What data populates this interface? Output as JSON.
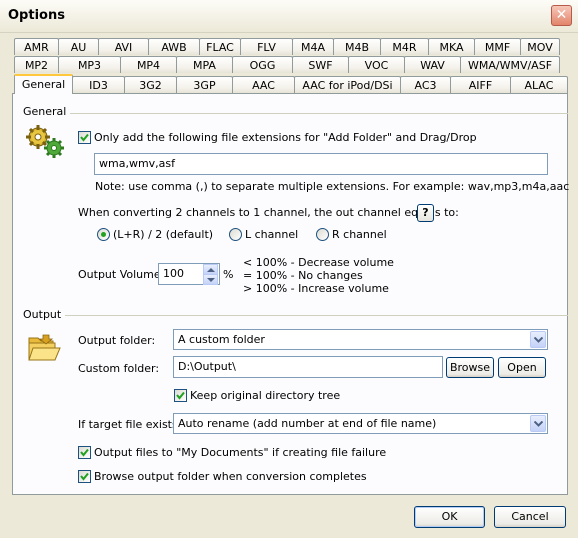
{
  "window": {
    "title": "Options",
    "close_glyph": "✕"
  },
  "tabs_row1": [
    "AMR",
    "AU",
    "AVI",
    "AWB",
    "FLAC",
    "FLV",
    "M4A",
    "M4B",
    "M4R",
    "MKA",
    "MMF",
    "MOV"
  ],
  "tabs_row2": [
    "MP2",
    "MP3",
    "MP4",
    "MPA",
    "OGG",
    "SWF",
    "VOC",
    "WAV",
    "WMA/WMV/ASF"
  ],
  "tabs_row3": [
    "General",
    "ID3",
    "3G2",
    "3GP",
    "AAC",
    "AAC for iPod/DSi",
    "AC3",
    "AIFF",
    "ALAC"
  ],
  "active_tab": "General",
  "general": {
    "group_label": "General",
    "only_add_label": "Only add the following file extensions for \"Add Folder\" and Drag/Drop",
    "only_add_checked": true,
    "extensions_value": "wma,wmv,asf",
    "note": "Note: use comma (,) to separate multiple extensions. For example: wav,mp3,m4a,aac",
    "channel_question": "When converting 2 channels to 1 channel, the out channel equals to:",
    "help_label": "?",
    "radio_lr": "(L+R) / 2 (default)",
    "radio_l": "L channel",
    "radio_r": "R channel",
    "selected_channel": "(L+R) / 2 (default)",
    "output_volume_label": "Output Volume:",
    "output_volume_value": "100",
    "percent": "%",
    "vol_note1": "< 100% - Decrease volume",
    "vol_note2": "= 100% - No changes",
    "vol_note3": "> 100% - Increase volume",
    "gear_icon": "gears-icon"
  },
  "output": {
    "group_label": "Output",
    "output_folder_label": "Output folder:",
    "output_folder_value": "A custom folder",
    "custom_folder_label": "Custom folder:",
    "custom_folder_value": "D:\\Output\\",
    "browse_label": "Browse",
    "open_label": "Open",
    "keep_tree_label": "Keep original directory tree",
    "keep_tree_checked": true,
    "if_exists_label": "If target file exists",
    "if_exists_value": "Auto rename (add number at end of file name)",
    "output_mydocs_label": "Output files to \"My Documents\" if creating file failure",
    "output_mydocs_checked": true,
    "browse_after_label": "Browse output folder when conversion completes",
    "browse_after_checked": true,
    "folder_icon": "folder-open-icon"
  },
  "footer": {
    "ok_label": "OK",
    "cancel_label": "Cancel"
  },
  "colors": {
    "window_bg": "#ECE9D8",
    "panel_bg": "#FCFCFE",
    "tab_highlight": "#FFC83C",
    "input_border": "#7F9DB9"
  }
}
